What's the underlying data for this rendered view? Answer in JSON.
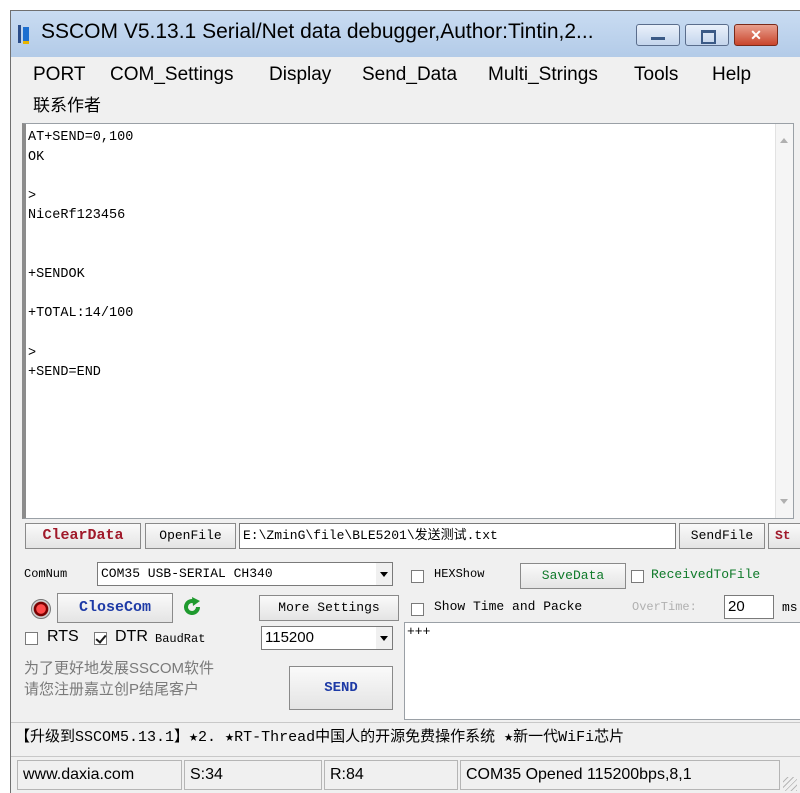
{
  "window": {
    "title": "SSCOM V5.13.1 Serial/Net data debugger,Author:Tintin,2..."
  },
  "menu": {
    "items": [
      "PORT",
      "COM_Settings",
      "Display",
      "Send_Data",
      "Multi_Strings",
      "Tools",
      "Help"
    ],
    "contact": "联系作者"
  },
  "receive": {
    "lines": [
      "AT+SEND=0,100",
      "OK",
      "",
      ">",
      "NiceRf123456",
      "",
      "",
      "+SENDOK",
      "",
      "+TOTAL:14/100",
      "",
      ">",
      "+SEND=END"
    ]
  },
  "file_row": {
    "clear_label": "ClearData",
    "open_label": "OpenFile",
    "path": "E:\\ZminG\\file\\BLE5201\\发送测试.txt",
    "sendfile_label": "SendFile",
    "stop_label": "St"
  },
  "com": {
    "comnum_label": "ComNum",
    "port_value": "COM35 USB-SERIAL CH340",
    "close_label": "CloseCom",
    "more_settings": "More Settings",
    "rts_label": "RTS",
    "dtr_label": "DTR",
    "baud_label": "BaudRat",
    "baud_value": "115200",
    "promo_line1": "为了更好地发展SSCOM软件",
    "promo_line2": "请您注册嘉立创P结尾客户",
    "send_label": "SEND"
  },
  "options": {
    "hexshow_label": "HEXShow",
    "savedata_label": "SaveData",
    "receivedtofile_label": "ReceivedToFile",
    "showtime_label": "Show Time and Packe",
    "overtime_label": "OverTime:",
    "overtime_value": "20",
    "ms_label": "ms"
  },
  "send": {
    "text": "+++"
  },
  "ticker": {
    "text": "【升级到SSCOM5.13.1】★2. ★RT-Thread中国人的开源免费操作系统 ★新一代WiFi芯片"
  },
  "status": {
    "site": "www.daxia.com",
    "sent": "S:34",
    "received": "R:84",
    "port_status": "COM35 Opened  115200bps,8,1"
  },
  "colors": {
    "accent_red": "#a0192a",
    "accent_green": "#0f7a2a",
    "accent_blue": "#1d3aa6",
    "title_gradient": "#c9dcf2"
  }
}
